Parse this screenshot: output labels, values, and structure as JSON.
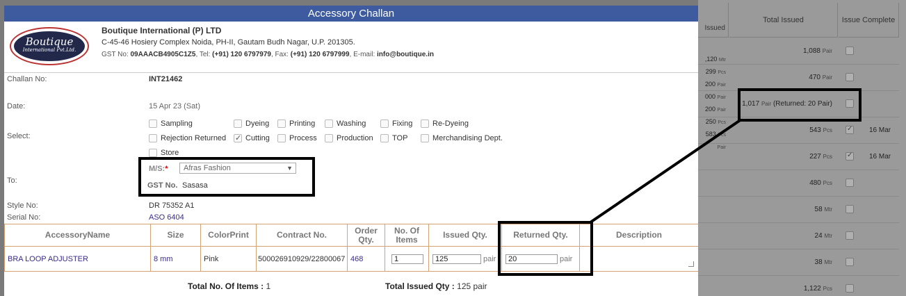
{
  "modal": {
    "title": "Accessory Challan"
  },
  "company": {
    "logo_line1": "Boutique",
    "logo_line2": "International Pvt.Ltd.",
    "name": "Boutique International (P) LTD",
    "address": "C-45-46 Hosiery Complex Noida, PH-II, Gautam Budh Nagar, U.P. 201305.",
    "gst_label": "GST No:",
    "gst_value": "09AAACB4905C1Z5",
    "tel_label": ", Tel:",
    "tel_value": "(+91) 120 6797979",
    "fax_label": ", Fax:",
    "fax_value": "(+91) 120 6797999",
    "email_label": ", E-mail:",
    "email_value": "info@boutique.in"
  },
  "form": {
    "challan_label": "Challan No:",
    "challan_value": "INT21462",
    "date_label": "Date:",
    "date_value": "15 Apr 23 (Sat)",
    "select_label": "Select:",
    "options": [
      {
        "label": "Sampling",
        "checked": false
      },
      {
        "label": "Dyeing",
        "checked": false
      },
      {
        "label": "Printing",
        "checked": false
      },
      {
        "label": "Washing",
        "checked": false
      },
      {
        "label": "Fixing",
        "checked": false
      },
      {
        "label": "Re-Dyeing",
        "checked": false
      },
      {
        "label": "Rejection Returned",
        "checked": false
      },
      {
        "label": "Cutting",
        "checked": true
      },
      {
        "label": "Process",
        "checked": false
      },
      {
        "label": "Production",
        "checked": false
      },
      {
        "label": "TOP",
        "checked": false
      },
      {
        "label": "Merchandising Dept.",
        "checked": false
      },
      {
        "label": "Store",
        "checked": false
      }
    ],
    "to_label": "To:",
    "ms_label": "M/S:",
    "ms_required": "*",
    "ms_value": "Afras Fashion",
    "gst_label": "GST No.",
    "gst_value": "Sasasa",
    "style_label": "Style No:",
    "style_value": "DR 75352 A1",
    "serial_label": "Serial No:",
    "serial_value": "ASO 6404"
  },
  "table": {
    "headers": [
      "AccessoryName",
      "Size",
      "ColorPrint",
      "Contract No.",
      "Order Qty.",
      "No. Of Items",
      "Issued Qty.",
      "Returned Qty.",
      "Description"
    ],
    "row": {
      "name": "BRA LOOP ADJUSTER",
      "size": "8 mm",
      "color": "Pink",
      "contract": "500026910929/22800067",
      "order_qty": "468",
      "items": "1",
      "issued": "125",
      "issued_unit": "pair",
      "returned": "20",
      "returned_unit": "pair",
      "description": ""
    }
  },
  "totals": {
    "items_label": "Total No. Of Items :",
    "items_value": "1",
    "issued_label": "Total Issued Qty :",
    "issued_value": "125 pair"
  },
  "background": {
    "header_issued": "Issued",
    "header_total_issued": "Total Issued",
    "header_issue_complete": "Issue Complete",
    "left_values": [
      {
        "num": ",120",
        "unit": "Mtr"
      },
      {
        "num": "299",
        "unit": "Pcs"
      },
      {
        "num": "200",
        "unit": "Pair"
      },
      {
        "num": "000",
        "unit": "Pair"
      },
      {
        "num": "200",
        "unit": "Pair"
      },
      {
        "num": "250",
        "unit": "Pcs"
      },
      {
        "num": "583",
        "unit": "Pcs"
      },
      {
        "num": "",
        "unit": "Pair"
      }
    ],
    "rows": [
      {
        "num": "1,088",
        "unit": "Pair",
        "suffix": "",
        "checked": false,
        "date": ""
      },
      {
        "num": "470",
        "unit": "Pair",
        "suffix": "",
        "checked": false,
        "date": ""
      },
      {
        "num": "1,017",
        "unit": "Pair",
        "suffix": "(Returned: 20 Pair)",
        "checked": false,
        "date": ""
      },
      {
        "num": "543",
        "unit": "Pcs",
        "suffix": "",
        "checked": true,
        "date": "16 Mar"
      },
      {
        "num": "227",
        "unit": "Pcs",
        "suffix": "",
        "checked": true,
        "date": "16 Mar"
      },
      {
        "num": "480",
        "unit": "Pcs",
        "suffix": "",
        "checked": false,
        "date": ""
      },
      {
        "num": "58",
        "unit": "Mtr",
        "suffix": "",
        "checked": false,
        "date": ""
      },
      {
        "num": "24",
        "unit": "Mtr",
        "suffix": "",
        "checked": false,
        "date": ""
      },
      {
        "num": "38",
        "unit": "Mtr",
        "suffix": "",
        "checked": false,
        "date": ""
      },
      {
        "num": "1,122",
        "unit": "Pcs",
        "suffix": "",
        "checked": false,
        "date": ""
      }
    ]
  }
}
